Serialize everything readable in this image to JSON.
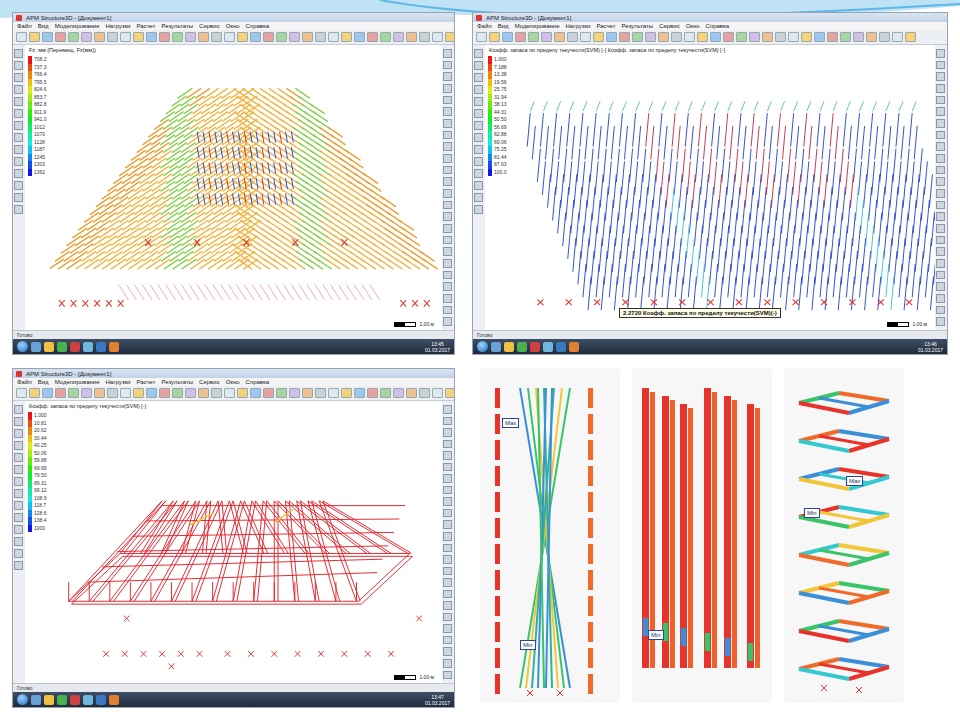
{
  "screens": [
    {
      "title": "APM Structure3D - [Документ1]",
      "menu": [
        "Файл",
        "Вид",
        "Моделирование",
        "Нагрузки",
        "Расчет",
        "Результаты",
        "Сервис",
        "Окно",
        "Справка"
      ],
      "caption": "Fz, мм (Перемещ. Fz(мм))",
      "legend": [
        "708.2",
        "737.3",
        "766.4",
        "795.5",
        "824.6",
        "853.7",
        "882.8",
        "911.9",
        "941.0",
        "1012",
        "1070",
        "1128",
        "1187",
        "1245",
        "1303",
        "1362"
      ],
      "scale": "1.00 м",
      "status": "Готово",
      "clock": "13:45",
      "date": "01.03.2017"
    },
    {
      "title": "APM Structure3D - [Документ1]",
      "menu": [
        "Файл",
        "Вид",
        "Моделирование",
        "Нагрузки",
        "Расчет",
        "Результаты",
        "Сервис",
        "Окно",
        "Справка"
      ],
      "caption": "Коэфф. запаса по пределу текучести(SVM) [-] Коэфф. запаса по пределу текучести(SVM) [-]",
      "legend": [
        "1.000",
        "7.188",
        "13.38",
        "19.56",
        "25.75",
        "31.94",
        "38.13",
        "44.31",
        "50.50",
        "56.69",
        "62.88",
        "69.06",
        "75.25",
        "81.44",
        "87.63",
        "100.0"
      ],
      "scale": "1.00 м",
      "status": "Готово",
      "clock": "13:46",
      "date": "01.03.2017",
      "tooltip": "2.2720 Коэфф. запаса по пределу текучести(SVM)(-)"
    },
    {
      "title": "APM Structure3D - [Документ1]",
      "menu": [
        "Файл",
        "Вид",
        "Моделирование",
        "Нагрузки",
        "Расчет",
        "Результаты",
        "Сервис",
        "Окно",
        "Справка"
      ],
      "caption": "Коэфф. запаса по пределу текучести(SVM) [-]",
      "legend": [
        "1.000",
        "10.81",
        "20.62",
        "30.44",
        "40.25",
        "50.06",
        "59.88",
        "69.69",
        "79.50",
        "89.31",
        "99.12",
        "108.9",
        "118.7",
        "128.6",
        "138.4",
        "1000"
      ],
      "scale": "1.00 м",
      "status": "Готово",
      "clock": "13:47",
      "date": "01.03.2017"
    }
  ],
  "renders": [
    {
      "badges": [
        "Max",
        "Min"
      ]
    },
    {
      "badges": [
        "Min"
      ]
    },
    {
      "badges": [
        "Min",
        "Max"
      ]
    }
  ]
}
